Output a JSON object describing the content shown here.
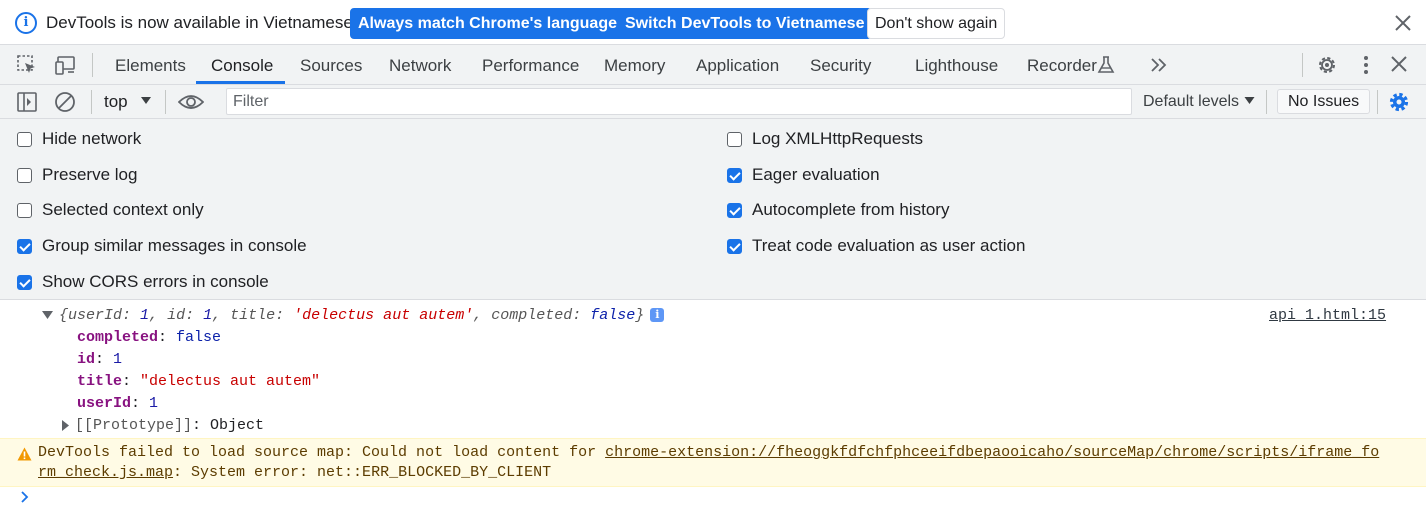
{
  "infobar": {
    "message": "DevTools is now available in Vietnamese!",
    "always_match_label": "Always match Chrome's language",
    "switch_label": "Switch DevTools to Vietnamese",
    "dont_show_label": "Don't show again",
    "accent_color": "#1a73e8"
  },
  "tabs": [
    {
      "label": "Elements"
    },
    {
      "label": "Console",
      "active": true
    },
    {
      "label": "Sources"
    },
    {
      "label": "Network"
    },
    {
      "label": "Performance"
    },
    {
      "label": "Memory"
    },
    {
      "label": "Application"
    },
    {
      "label": "Security"
    },
    {
      "label": "Lighthouse"
    },
    {
      "label": "Recorder"
    }
  ],
  "toolbar": {
    "context": "top",
    "filter_placeholder": "Filter",
    "levels_label": "Default levels",
    "issues_label": "No Issues"
  },
  "settings": {
    "left": [
      {
        "label": "Hide network",
        "checked": false
      },
      {
        "label": "Preserve log",
        "checked": false
      },
      {
        "label": "Selected context only",
        "checked": false
      },
      {
        "label": "Group similar messages in console",
        "checked": true
      },
      {
        "label": "Show CORS errors in console",
        "checked": true
      }
    ],
    "right": [
      {
        "label": "Log XMLHttpRequests",
        "checked": false
      },
      {
        "label": "Eager evaluation",
        "checked": true
      },
      {
        "label": "Autocomplete from history",
        "checked": true
      },
      {
        "label": "Treat code evaluation as user action",
        "checked": true
      }
    ]
  },
  "console": {
    "object_summary": {
      "open": "{",
      "k1": "userId",
      "v1": "1",
      "k2": "id",
      "v2": "1",
      "k3": "title",
      "v3": "'delectus aut autem'",
      "k4": "completed",
      "v4": "false",
      "close": "}"
    },
    "source_link": "api_1.html:15",
    "props": [
      {
        "key": "completed",
        "value": "false"
      },
      {
        "key": "id",
        "value": "1"
      },
      {
        "key": "title",
        "value": "\"delectus aut autem\""
      },
      {
        "key": "userId",
        "value": "1"
      }
    ],
    "prototype_key": "[[Prototype]]",
    "prototype_value": "Object",
    "warning": {
      "prefix": "DevTools failed to load source map: Could not load content for ",
      "link_part1": "chrome-extension://fheoggkfdfchfphceeifdbepaooicaho/sourceMap/chrome/scripts/iframe_fo",
      "link_part2": "rm_check.js.map",
      "suffix": ": System error: net::ERR_BLOCKED_BY_CLIENT"
    }
  }
}
